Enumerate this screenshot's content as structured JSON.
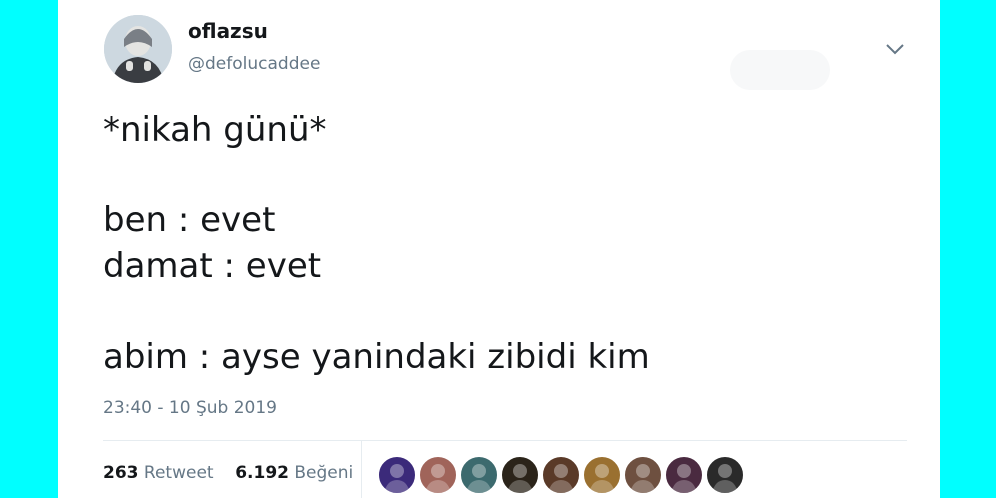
{
  "user": {
    "display_name": "oflazsu",
    "handle": "@defolucaddee",
    "avatar_icon": "profile-photo"
  },
  "tweet": {
    "lines": [
      "*nikah günü*",
      "ben : evet",
      "damat : evet",
      "abim : ayse yanindaki zibidi kim"
    ],
    "timestamp": "23:40 - 10 Şub 2019"
  },
  "stats": {
    "retweet_count": "263",
    "retweet_label": "Retweet",
    "like_count": "6.192",
    "like_label": "Beğeni"
  },
  "likers": [
    {
      "icon": "liker-avatar",
      "color": "#3b2a7a"
    },
    {
      "icon": "liker-avatar",
      "color": "#a0645a"
    },
    {
      "icon": "liker-avatar",
      "color": "#3c6a6e"
    },
    {
      "icon": "liker-avatar",
      "color": "#2b241a"
    },
    {
      "icon": "liker-avatar",
      "color": "#5a3a28"
    },
    {
      "icon": "liker-avatar",
      "color": "#9a7030"
    },
    {
      "icon": "liker-avatar",
      "color": "#6e5040"
    },
    {
      "icon": "liker-avatar",
      "color": "#4a2a40"
    },
    {
      "icon": "liker-avatar",
      "color": "#2a2a2a"
    }
  ],
  "colors": {
    "background": "#00ffff",
    "card": "#ffffff",
    "text": "#14171a",
    "muted": "#657786"
  }
}
